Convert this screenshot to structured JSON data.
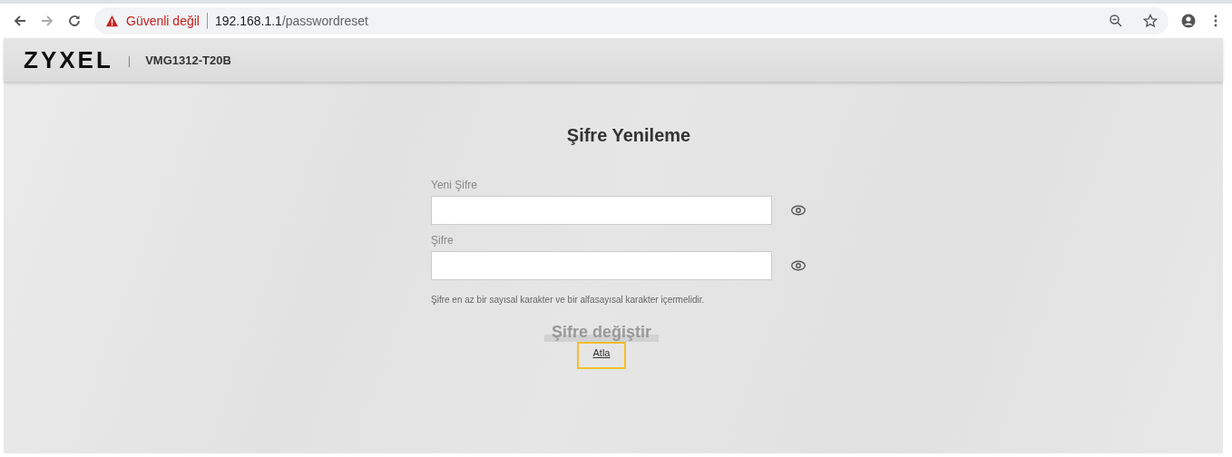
{
  "browser": {
    "security_label": "Güvenli değil",
    "url_host": "192.168.1.1",
    "url_path": "/passwordreset"
  },
  "header": {
    "logo": "ZYXEL",
    "separator": "|",
    "model": "VMG1312-T20B"
  },
  "form": {
    "title": "Şifre Yenileme",
    "fields": [
      {
        "label": "Yeni Şifre"
      },
      {
        "label": "Şifre"
      }
    ],
    "hint": "Şifre en az bir sayısal karakter ve bir alfasayısal karakter içermelidir.",
    "submit": {
      "label": "Şifre değiştir",
      "disabled": true
    },
    "skip_link": {
      "label": "Atla",
      "highlighted": true
    }
  }
}
